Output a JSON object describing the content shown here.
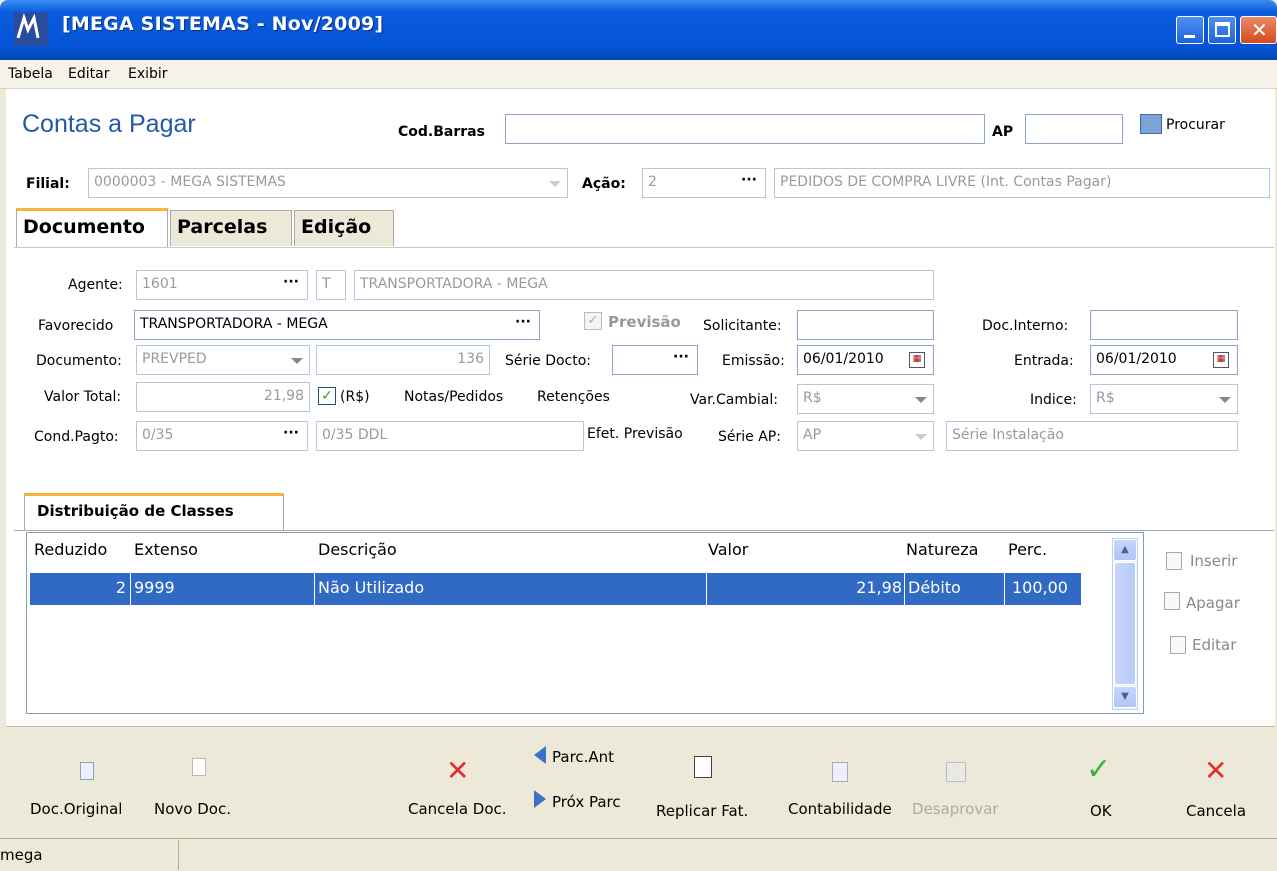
{
  "window": {
    "title": "[MEGA SISTEMAS - Nov/2009]"
  },
  "menu": [
    "Tabela",
    "Editar",
    "Exibir"
  ],
  "header": {
    "title": "Contas a Pagar",
    "codbarras_label": "Cod.Barras",
    "codbarras_value": "",
    "ap_label": "AP",
    "ap_value": "",
    "procurar_label": "Procurar"
  },
  "filial": {
    "label": "Filial:",
    "value": "0000003 - MEGA SISTEMAS",
    "acao_label": "Ação:",
    "acao_value": "2",
    "acao_desc": "PEDIDOS DE COMPRA LIVRE (Int. Contas Pagar)"
  },
  "tabs": [
    "Documento",
    "Parcelas",
    "Edição"
  ],
  "form": {
    "agente_label": "Agente:",
    "agente_code": "1601",
    "agente_type": "T",
    "agente_name": "TRANSPORTADORA - MEGA",
    "favorecido_label": "Favorecido",
    "favorecido_value": "TRANSPORTADORA - MEGA",
    "previsao_label": "Previsão",
    "solicitante_label": "Solicitante:",
    "solicitante_value": "",
    "docinterno_label": "Doc.Interno:",
    "docinterno_value": "",
    "documento_label": "Documento:",
    "documento_value": "PREVPED",
    "documento_num": "136",
    "seriedocto_label": "Série Docto:",
    "seriedocto_value": "",
    "emissao_label": "Emissão:",
    "emissao_value": "06/01/2010",
    "entrada_label": "Entrada:",
    "entrada_value": "06/01/2010",
    "valortotal_label": "Valor Total:",
    "valortotal_value": "21,98",
    "rs_label": "(R$)",
    "notas_label": "Notas/Pedidos",
    "retencoes_label": "Retenções",
    "varcambial_label": "Var.Cambial:",
    "varcambial_value": "R$",
    "indice_label": "Indice:",
    "indice_value": "R$",
    "condpagto_label": "Cond.Pagto:",
    "condpagto_code": "0/35",
    "condpagto_desc": "0/35 DDL",
    "efetprevisao_label": "Efet. Previsão",
    "serieap_label": "Série AP:",
    "serieap_value": "AP",
    "serieinst_placeholder": "Série Instalação"
  },
  "distrib": {
    "tab": "Distribuição de Classes",
    "columns": [
      "Reduzido",
      "Extenso",
      "Descrição",
      "Valor",
      "Natureza",
      "Perc."
    ],
    "rows": [
      [
        "2",
        "9999",
        "Não Utilizado",
        "21,98",
        "Débito",
        "100,00"
      ]
    ],
    "inserir": "Inserir",
    "apagar": "Apagar",
    "editar": "Editar"
  },
  "bottom": {
    "doc_original": "Doc.Original",
    "novo_doc": "Novo Doc.",
    "cancela_doc": "Cancela Doc.",
    "parc_ant": "Parc.Ant",
    "prox_parc": "Próx Parc",
    "replicar": "Replicar Fat.",
    "contabilidade": "Contabilidade",
    "desaprovar": "Desaprovar",
    "ok": "OK",
    "cancela": "Cancela"
  },
  "status": {
    "user": "mega"
  }
}
